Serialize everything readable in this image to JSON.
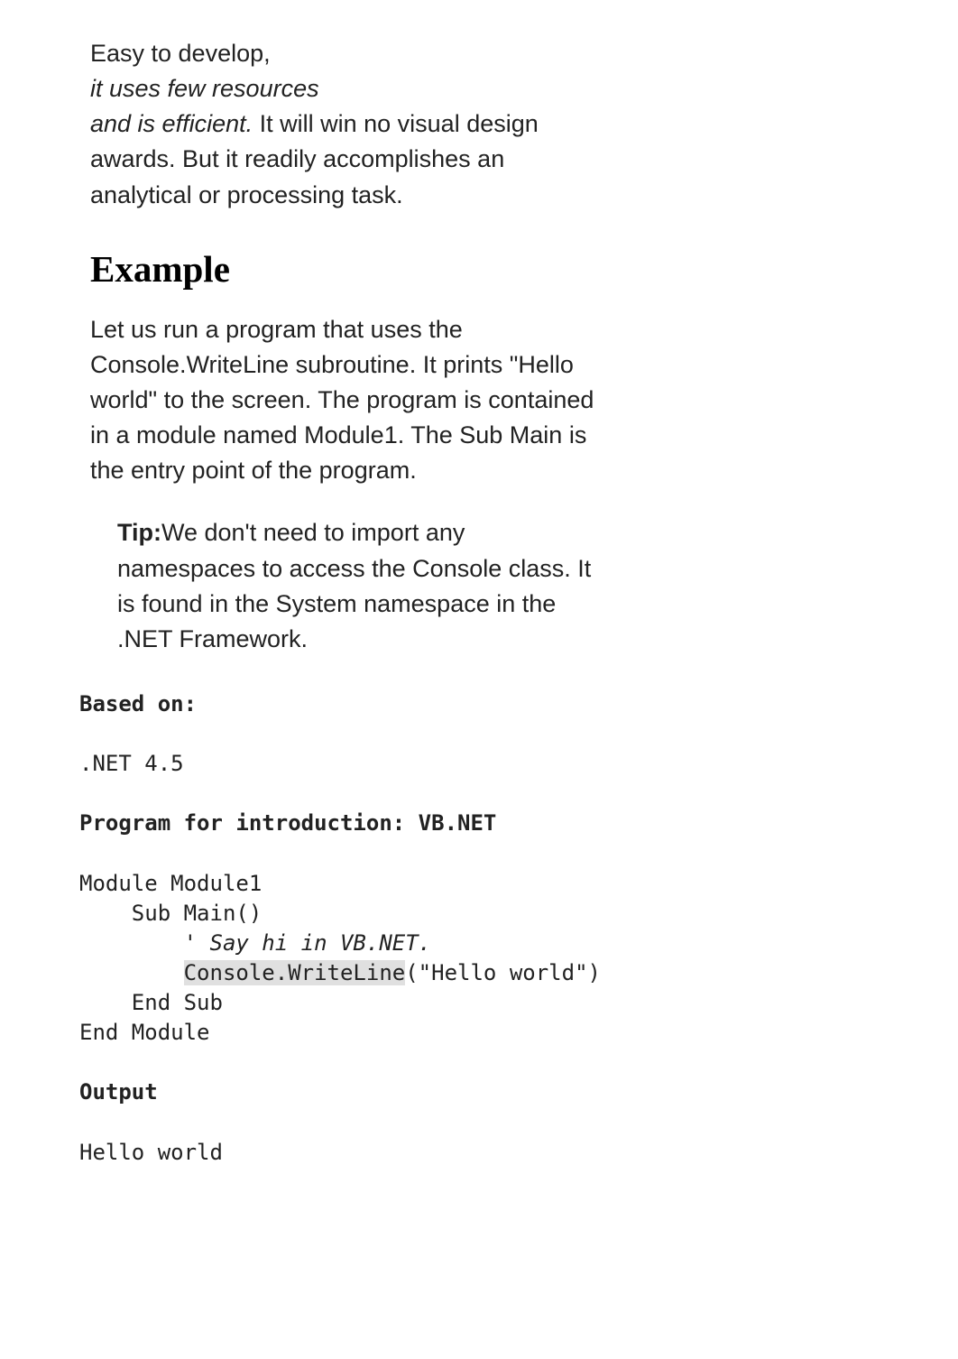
{
  "intro": {
    "line1": "Easy to develop,",
    "italic1": "it uses few resources",
    "italic2": "and is efficient.",
    "rest": " It will win no visual design awards. But it readily accomplishes an analytical or processing task."
  },
  "heading_example": "Example",
  "paragraph_example": "Let us run a program that uses the Console.WriteLine subroutine. It prints \"Hello world\" to the screen. The program is contained in a module named Module1. The Sub Main is the entry point of the program.",
  "tip": {
    "label": "Tip:",
    "text": "We don't need to import any namespaces to access the Console class. It is found in the System namespace in the .NET Framework."
  },
  "code": {
    "based_on_label": "Based on:",
    "based_on_value": ".NET 4.5",
    "program_label": "Program for introduction: VB.NET",
    "l1": "Module Module1",
    "l2": "    Sub Main()",
    "l3_comment": "        ' Say hi in VB.NET.",
    "l4a": "        ",
    "l4_highlight": "Console.WriteLine",
    "l4b": "(\"Hello world\")",
    "l5": "    End Sub",
    "l6": "End Module",
    "output_label": "Output",
    "output_value": "Hello world"
  }
}
